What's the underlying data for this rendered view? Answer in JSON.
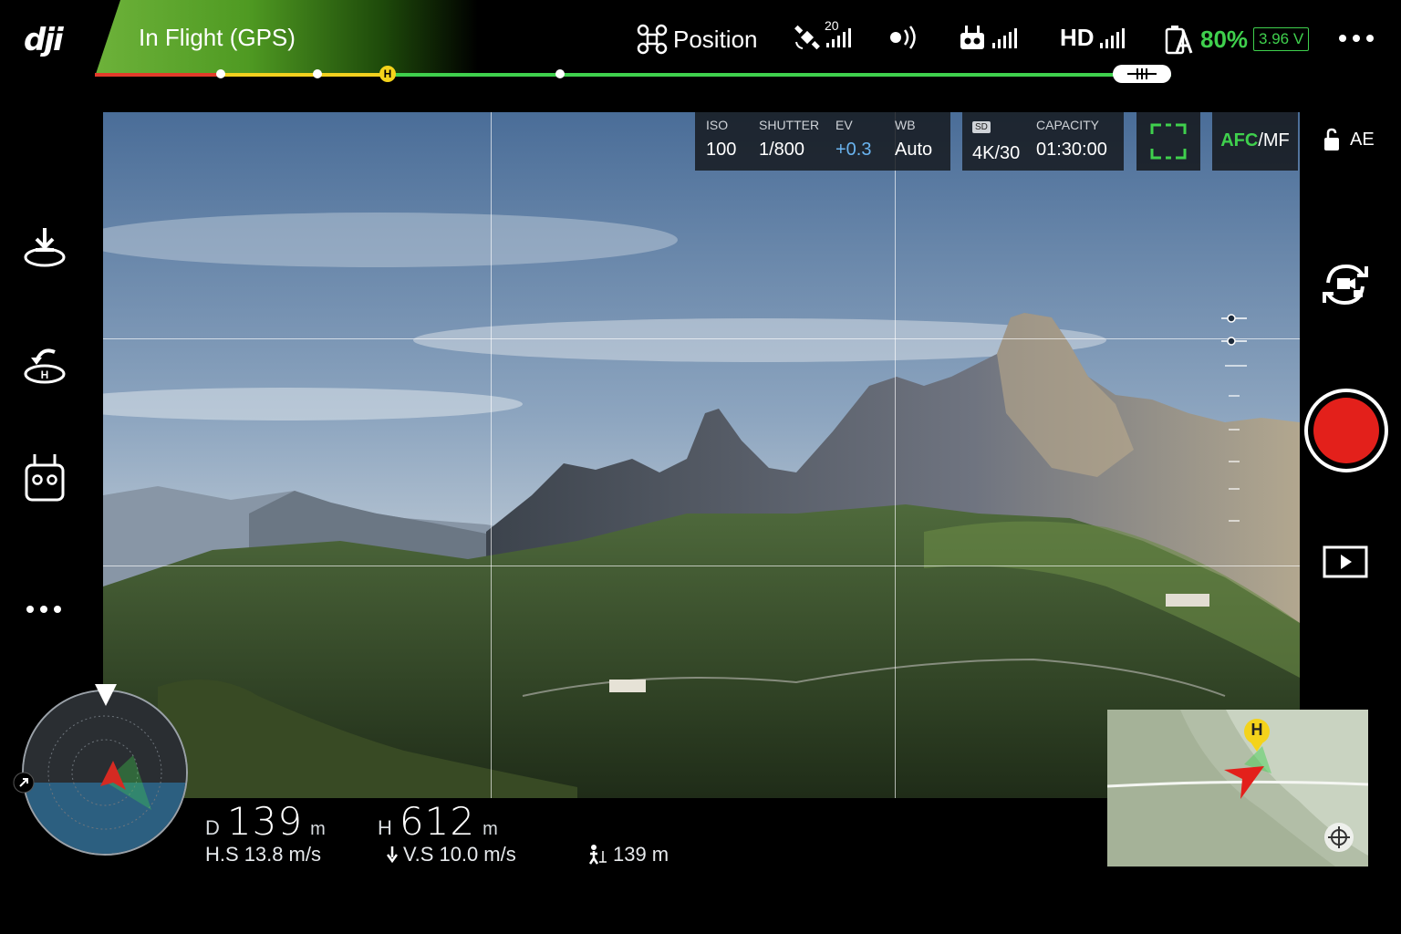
{
  "app": {
    "logo": "dji"
  },
  "header": {
    "flight_status": "In Flight (GPS)",
    "flight_mode": "Position",
    "satellite_count": "20",
    "video_link": "HD",
    "battery_percent": "80%",
    "battery_voltage": "3.96 V",
    "battery_level": 0.8,
    "signal_levels": {
      "gps": 5,
      "remote": 4,
      "hd": 4
    }
  },
  "icons": {
    "mode": "drone-icon",
    "satellite": "satellite-icon",
    "beacon": "obstacle-sensing-icon",
    "remote": "remote-controller-icon",
    "battery": "battery-icon",
    "more": "more-icon"
  },
  "camera": {
    "iso_label": "ISO",
    "iso_value": "100",
    "shutter_label": "SHUTTER",
    "shutter_value": "1/800",
    "ev_label": "EV",
    "ev_value": "+0.3",
    "wb_label": "WB",
    "wb_value": "Auto",
    "storage_badge": "SD",
    "resolution_value": "4K/30",
    "capacity_label": "CAPACITY",
    "capacity_value": "01:30:00",
    "focus_mode_afc": "AFC",
    "focus_mode_sep": "/",
    "focus_mode_mf": "MF",
    "ae_label": "AE"
  },
  "telemetry": {
    "distance_label": "D",
    "distance_value": "139",
    "distance_unit": "m",
    "height_label": "H",
    "height_value": "612",
    "height_unit": "m",
    "hspeed_label": "H.S",
    "hspeed_value": "13.8",
    "hspeed_unit": "m/s",
    "vspeed_label": "V.S",
    "vspeed_value": "10.0",
    "vspeed_unit": "m/s",
    "pilot_distance_value": "139",
    "pilot_distance_unit": "m"
  },
  "minimap": {
    "home_marker": "H"
  },
  "colors": {
    "accent_green": "#3fd04d",
    "record_red": "#e3201b",
    "home_yellow": "#f4d31b",
    "ev_blue": "#6ab4f0"
  }
}
